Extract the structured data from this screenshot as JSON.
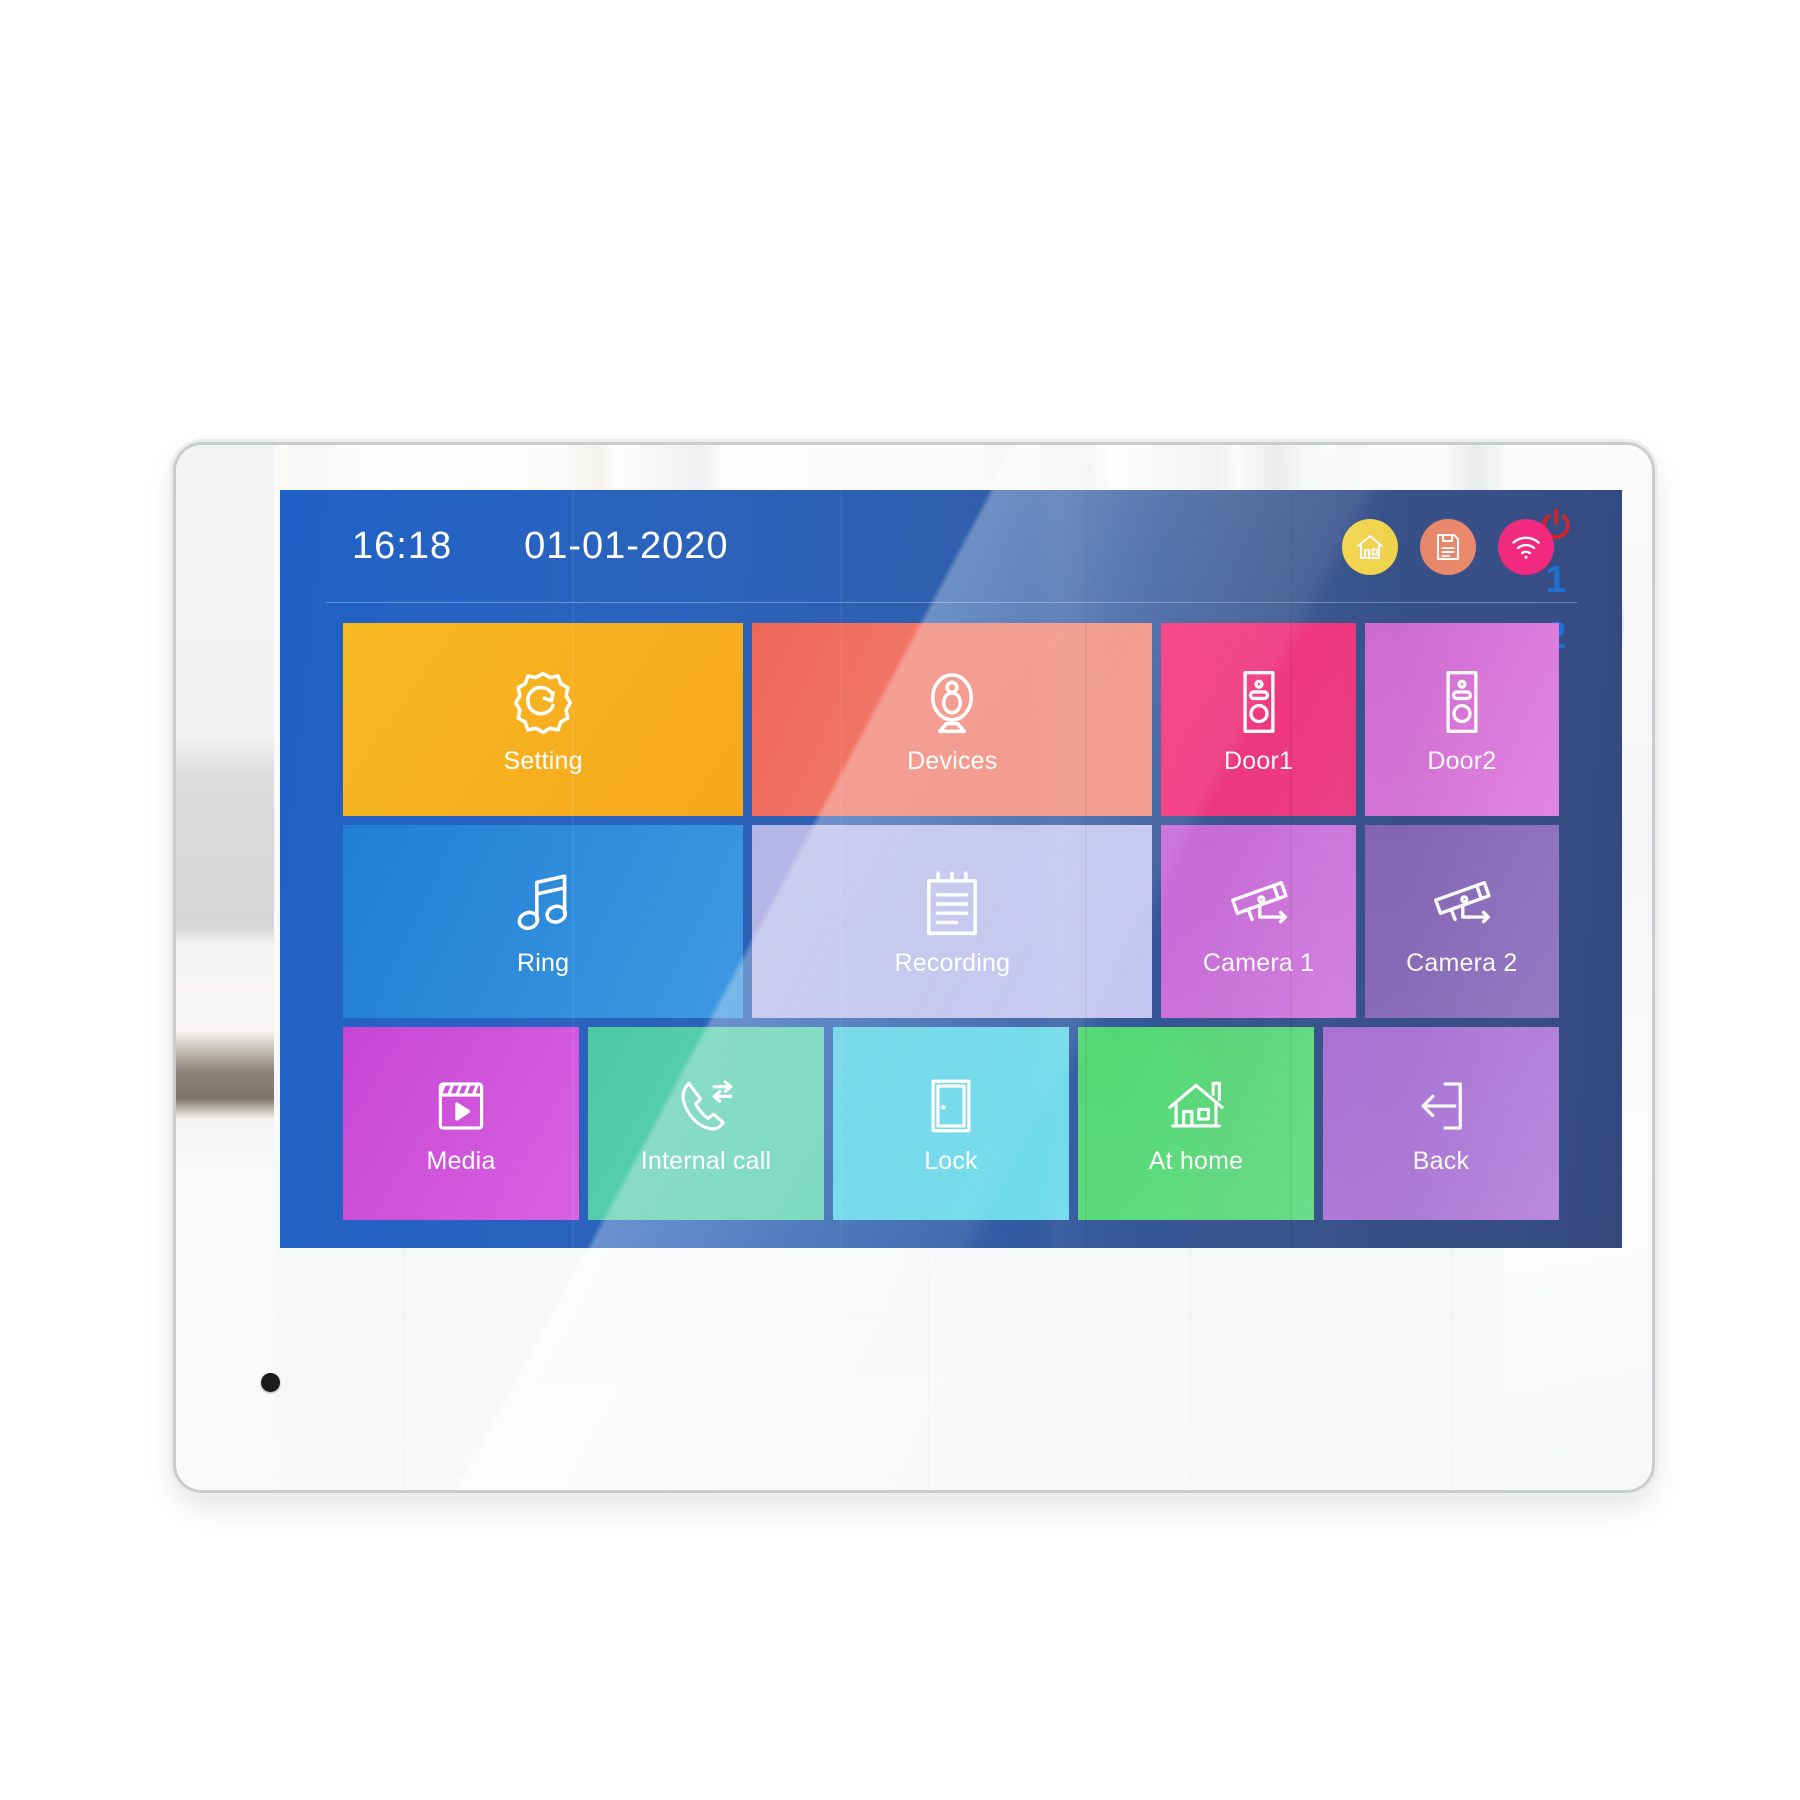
{
  "device": {
    "label": "smart-video-intercom-monitor",
    "side_keys": {
      "power_icon": "power-icon",
      "power_color": "#d3222a",
      "numbers": [
        "1",
        "2"
      ],
      "number_color": "#1d6fd0"
    },
    "microphone": "microphone-pinhole"
  },
  "screen": {
    "background_from": "#2061c7",
    "background_to": "#34487e",
    "statusbar": {
      "time": "16:18",
      "date": "01-01-2020",
      "icons": [
        {
          "name": "home-icon",
          "color": "#f7d94c"
        },
        {
          "name": "document-icon",
          "color": "#ef8a6a"
        },
        {
          "name": "wifi-icon",
          "color": "#f4277e"
        }
      ]
    },
    "grid": {
      "rows": [
        {
          "row_name": "row-1",
          "tiles": [
            {
              "label": "Setting",
              "icon": "gear-icon",
              "size": "wide",
              "color_from": "#f8b923",
              "color_to": "#f5a81c"
            },
            {
              "label": "Devices",
              "icon": "webcam-icon",
              "size": "wide",
              "color_from": "#ef6a5b",
              "color_to": "#f19080"
            },
            {
              "label": "Door1",
              "icon": "doorbell-icon",
              "size": "narrow",
              "color_from": "#f72873",
              "color_to": "#ec3f86"
            },
            {
              "label": "Door2",
              "icon": "doorbell-icon",
              "size": "narrow",
              "color_from": "#d46ad6",
              "color_to": "#e07fe0"
            }
          ]
        },
        {
          "row_name": "row-2",
          "tiles": [
            {
              "label": "Ring",
              "icon": "music-note-icon",
              "size": "wide",
              "color_from": "#1f7fd4",
              "color_to": "#3d97e0"
            },
            {
              "label": "Recording",
              "icon": "notepad-icon",
              "size": "wide",
              "color_from": "#b5b6e8",
              "color_to": "#c2c3ee"
            },
            {
              "label": "Camera 1",
              "icon": "cctv-icon",
              "size": "narrow",
              "color_from": "#c766d8",
              "color_to": "#d37ce0"
            },
            {
              "label": "Camera 2",
              "icon": "cctv-icon",
              "size": "narrow",
              "color_from": "#8364b6",
              "color_to": "#9073bf"
            }
          ]
        },
        {
          "row_name": "row-3",
          "tiles": [
            {
              "label": "Media",
              "icon": "film-play-icon",
              "color_from": "#c646d4",
              "color_to": "#d55fe0"
            },
            {
              "label": "Internal call",
              "icon": "phone-call-icon",
              "color_from": "#4cc9a4",
              "color_to": "#62d3b1"
            },
            {
              "label": "Lock",
              "icon": "door-icon",
              "color_from": "#55cfe3",
              "color_to": "#6fd9ea"
            },
            {
              "label": "At home",
              "icon": "house-icon",
              "color_from": "#4fd66f",
              "color_to": "#66de85"
            },
            {
              "label": "Back",
              "icon": "exit-arrow-icon",
              "color_from": "#a96fd6",
              "color_to": "#b684df"
            }
          ]
        }
      ]
    }
  }
}
